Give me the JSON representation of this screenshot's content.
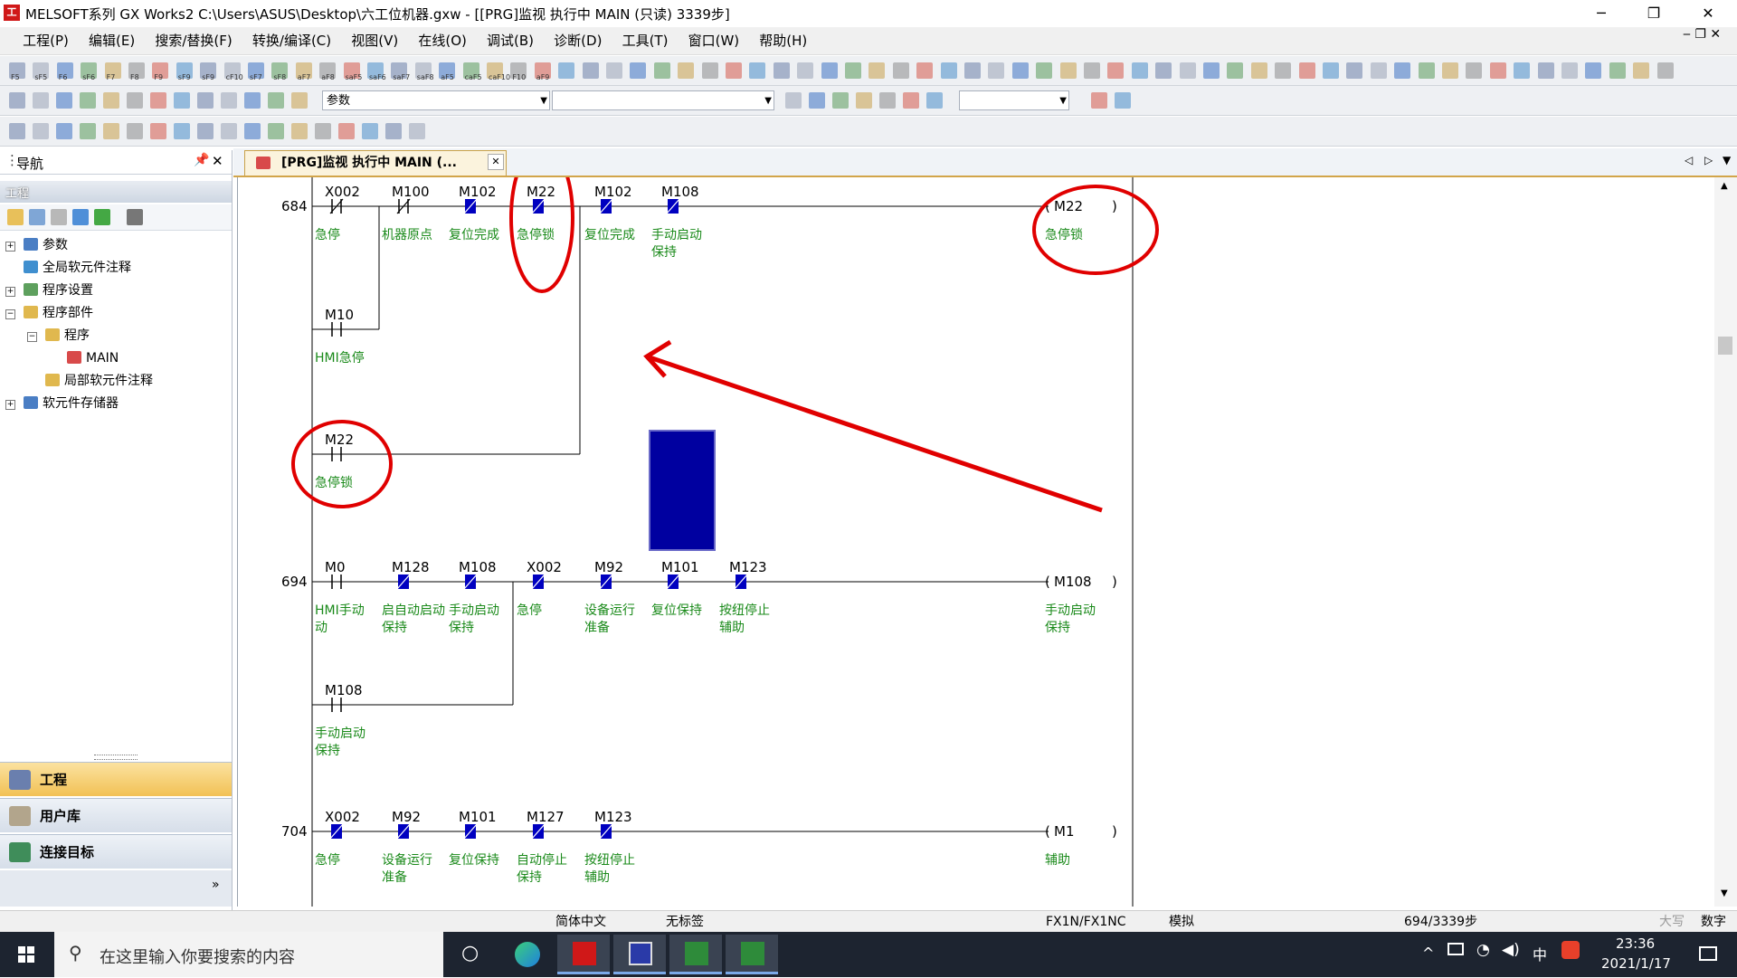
{
  "window": {
    "title": "MELSOFT系列 GX Works2 C:\\Users\\ASUS\\Desktop\\六工位机器.gxw - [[PRG]监视 执行中 MAIN (只读) 3339步]"
  },
  "menu": [
    "工程(P)",
    "编辑(E)",
    "搜索/替换(F)",
    "转换/编译(C)",
    "视图(V)",
    "在线(O)",
    "调试(B)",
    "诊断(D)",
    "工具(T)",
    "窗口(W)",
    "帮助(H)"
  ],
  "toolbar": {
    "fkeys": [
      "F5",
      "sF5",
      "F6",
      "sF6",
      "F7",
      "F8",
      "F9",
      "sF9",
      "sF9",
      "cF10",
      "sF7",
      "sF8",
      "aF7",
      "aF8",
      "saF5",
      "saF6",
      "saF7",
      "saF8",
      "aF5",
      "caF5",
      "caF10",
      "F10",
      "aF9"
    ],
    "combo1": "参数"
  },
  "nav": {
    "header": "导航",
    "section": "工程",
    "tree": [
      "参数",
      "全局软元件注释",
      "程序设置",
      "程序部件",
      "程序",
      "MAIN",
      "局部软元件注释",
      "软元件存储器"
    ],
    "tabs": [
      "工程",
      "用户库",
      "连接目标"
    ]
  },
  "editor": {
    "tab": "[PRG]监视 执行中 MAIN (...",
    "rungs": [
      {
        "step": "684",
        "contacts": [
          {
            "dev": "X002",
            "label": "急停"
          },
          {
            "dev": "M100",
            "label": "机器原点"
          },
          {
            "dev": "M102",
            "label": "复位完成"
          },
          {
            "dev": "M22",
            "label": "急停锁"
          },
          {
            "dev": "M102",
            "label": "复位完成"
          },
          {
            "dev": "M108",
            "label": "手动启动",
            "label2": "保持"
          }
        ],
        "branch1": {
          "dev": "M10",
          "label": "HMI急停"
        },
        "branch2": {
          "dev": "M22",
          "label": "急停锁"
        },
        "coil": {
          "dev": "M22",
          "label": "急停锁"
        }
      },
      {
        "step": "694",
        "contacts": [
          {
            "dev": "M0",
            "label": "HMI手动",
            "label2": "动"
          },
          {
            "dev": "M128",
            "label": "启自动启动",
            "label2": "保持"
          },
          {
            "dev": "M108",
            "label": "手动启动",
            "label2": "保持"
          },
          {
            "dev": "X002",
            "label": "急停"
          },
          {
            "dev": "M92",
            "label": "设备运行",
            "label2": "准备"
          },
          {
            "dev": "M101",
            "label": "复位保持"
          },
          {
            "dev": "M123",
            "label": "按纽停止",
            "label2": "辅助"
          }
        ],
        "branch1": {
          "dev": "M108",
          "label": "手动启动",
          "label2": "保持"
        },
        "coil": {
          "dev": "M108",
          "label": "手动启动",
          "label2": "保持"
        }
      },
      {
        "step": "704",
        "contacts": [
          {
            "dev": "X002",
            "label": "急停"
          },
          {
            "dev": "M92",
            "label": "设备运行",
            "label2": "准备"
          },
          {
            "dev": "M101",
            "label": "复位保持"
          },
          {
            "dev": "M127",
            "label": "自动停止",
            "label2": "保持"
          },
          {
            "dev": "M123",
            "label": "按纽停止",
            "label2": "辅助"
          }
        ],
        "coil": {
          "dev": "M1",
          "label": "辅助"
        }
      }
    ]
  },
  "status": {
    "lang": "简体中文",
    "tag": "无标签",
    "cpu": "FX1N/FX1NC",
    "mode": "模拟",
    "steps": "694/3339步",
    "caps": "大写",
    "num": "数字"
  },
  "taskbar": {
    "search": "在这里输入你要搜索的内容",
    "time": "23:36",
    "date": "2021/1/17",
    "ime": "中"
  },
  "colors": {
    "accent": "#0000a0",
    "label": "#1a8a1a",
    "annotation": "#e00000"
  }
}
